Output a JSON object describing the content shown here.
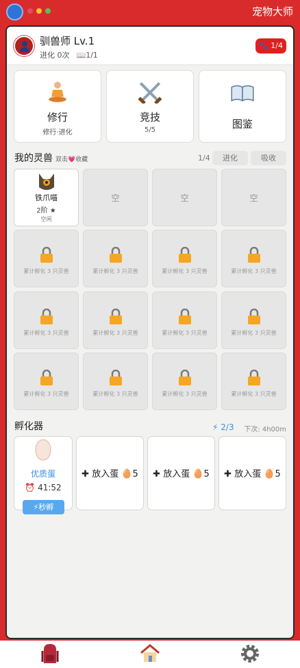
{
  "app": {
    "title": "宠物大师"
  },
  "header": {
    "name": "驯兽师 Lv.1",
    "evolve": "进化 0次",
    "book_count": "1/1",
    "badge": "1/4"
  },
  "cards": [
    {
      "title": "修行",
      "sub": "修行·进化",
      "icon": "meditation-icon"
    },
    {
      "title": "竞技",
      "sub": "5/5",
      "icon": "crossed-swords-icon"
    },
    {
      "title": "图鉴",
      "sub": "",
      "icon": "book-icon"
    }
  ],
  "pets": {
    "title": "我的灵兽",
    "hint": "双击💗收藏",
    "count": "1/4",
    "evolve_btn": "进化",
    "absorb_btn": "吸收",
    "pet": {
      "name": "铁爪喵",
      "level": "2阶 ★",
      "status": "空闲"
    },
    "empty_label": "空",
    "locked_label": "累计孵化 3 只灵兽"
  },
  "incubator": {
    "title": "孵化器",
    "energy": "2/3",
    "next": "下次: 4h00m",
    "egg_name": "优质蛋",
    "timer": "41:52",
    "speed_btn": "秒孵",
    "put_label": "放入蛋",
    "put_cost": "5"
  },
  "colors": {
    "brand_red": "#d92b2b",
    "accent_blue": "#3a8fe0"
  }
}
